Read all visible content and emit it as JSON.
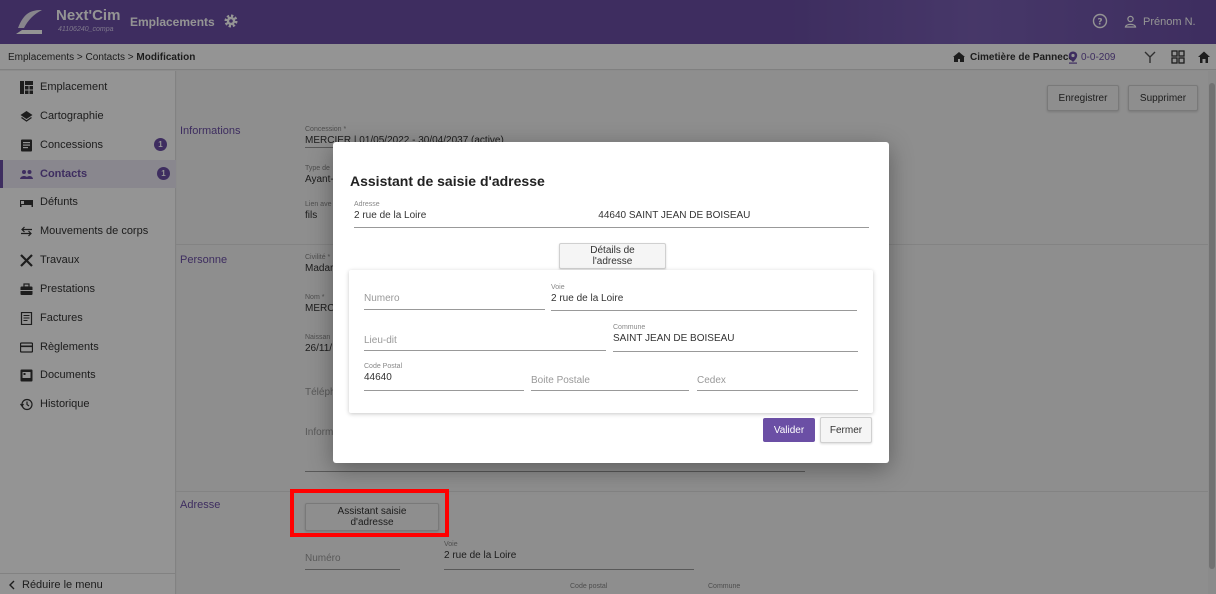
{
  "app": {
    "brand": "Next'Cim",
    "brand_sub": "41106240_compa",
    "module": "Emplacements",
    "user": "Prénom N."
  },
  "breadcrumb": {
    "part1": "Emplacements",
    "sep": ">",
    "part2": "Contacts",
    "part3": "Modification"
  },
  "toolbar": {
    "cemetery": "Cimetière de Pannecé",
    "location": "0-0-209"
  },
  "sidebar": {
    "items": [
      {
        "label": "Emplacement",
        "icon": "grid-icon"
      },
      {
        "label": "Cartographie",
        "icon": "layers-icon"
      },
      {
        "label": "Concessions",
        "icon": "book-icon",
        "badge": "1"
      },
      {
        "label": "Contacts",
        "icon": "people-icon",
        "badge": "1",
        "active": true
      },
      {
        "label": "Défunts",
        "icon": "bed-icon"
      },
      {
        "label": "Mouvements de corps",
        "icon": "swap-icon"
      },
      {
        "label": "Travaux",
        "icon": "tools-icon"
      },
      {
        "label": "Prestations",
        "icon": "briefcase-icon"
      },
      {
        "label": "Factures",
        "icon": "receipt-icon"
      },
      {
        "label": "Règlements",
        "icon": "card-icon"
      },
      {
        "label": "Documents",
        "icon": "document-icon"
      },
      {
        "label": "Historique",
        "icon": "history-icon"
      }
    ],
    "reduce_label": "Réduire le menu"
  },
  "main": {
    "save_label": "Enregistrer",
    "delete_label": "Supprimer",
    "sections": {
      "informations": "Informations",
      "personne": "Personne",
      "adresse": "Adresse"
    },
    "fields": {
      "concession_label": "Concession *",
      "concession_value": "MERCIER | 01/05/2022 - 30/04/2037 (active)",
      "type_label": "Type de",
      "type_value": "Ayant-",
      "lien_label": "Lien ave",
      "lien_value": "fils",
      "civilite_label": "Civilité *",
      "civilite_value": "Madar",
      "nom_label": "Nom *",
      "nom_value": "MERC",
      "naissance_label": "Naissan",
      "naissance_value": "26/11/",
      "telephone_placeholder": "Téléph",
      "informations_placeholder": "Inform",
      "numero_placeholder": "Numéro",
      "voie_label": "Voie",
      "voie_value": "2 rue de la Loire",
      "code_postal_label": "Code postal",
      "commune_label": "Commune"
    },
    "assistant_button": "Assistant saisie d'adresse"
  },
  "dialog": {
    "title": "Assistant de saisie d'adresse",
    "adresse_label": "Adresse",
    "adresse_value": "2 rue de la Loire",
    "adresse_value2": "44640 SAINT JEAN DE BOISEAU",
    "details_button": "Détails de l'adresse",
    "numero_placeholder": "Numero",
    "voie_label": "Voie",
    "voie_value": "2 rue de la Loire",
    "lieu_dit_placeholder": "Lieu-dit",
    "commune_label": "Commune",
    "commune_value": "SAINT JEAN DE BOISEAU",
    "code_postal_label": "Code Postal",
    "code_postal_value": "44640",
    "boite_postale_placeholder": "Boite Postale",
    "cedex_placeholder": "Cedex",
    "validate_label": "Valider",
    "close_label": "Fermer"
  },
  "colors": {
    "brand": "#6b4fa5",
    "highlight": "#ff0000"
  }
}
